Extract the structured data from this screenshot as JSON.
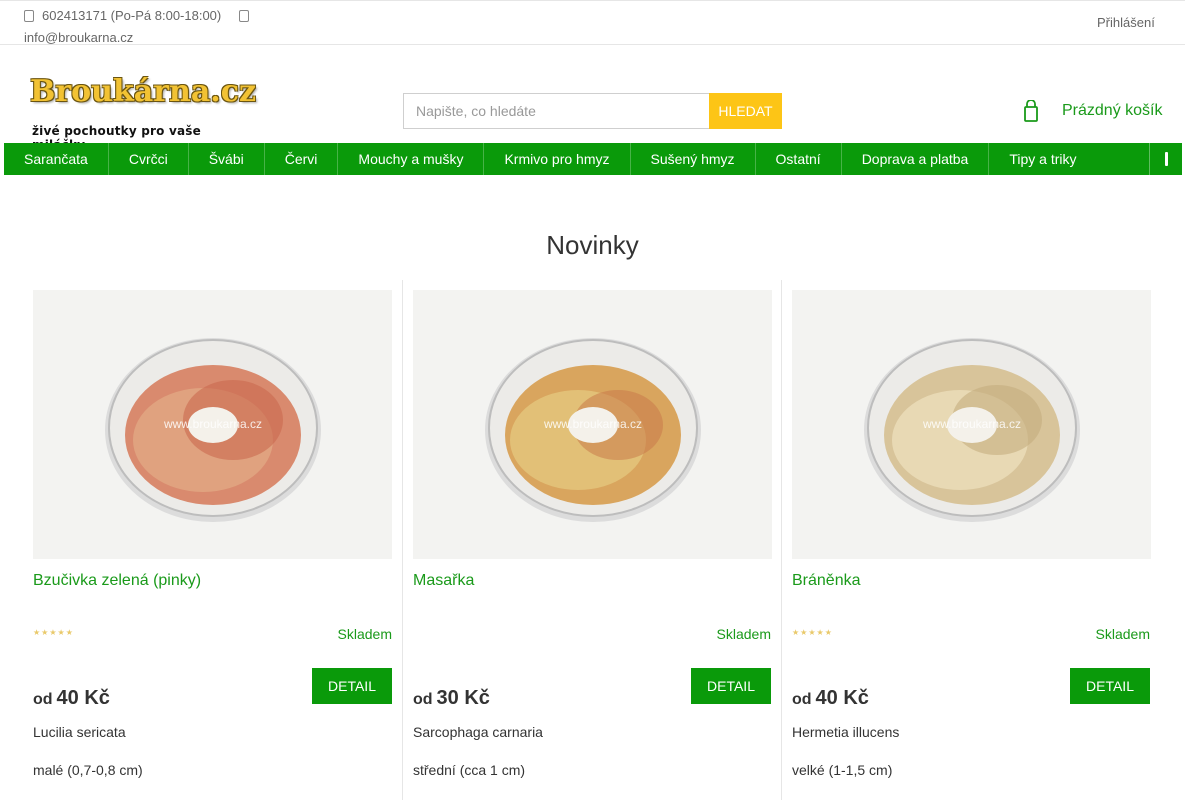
{
  "header": {
    "phone": "602413171 (Po-Pá 8:00-18:00)",
    "email": "info@broukarna.cz",
    "login_label": "Přihlášení",
    "phone_icon": "phone-icon",
    "email_icon": "envelope-icon"
  },
  "logo": {
    "title": "Broukárna.cz",
    "subtitle": "živé pochoutky pro vaše miláčky ..."
  },
  "search": {
    "placeholder": "Napište, co hledáte",
    "button_label": "HLEDAT"
  },
  "cart": {
    "label": "Prázdný košík",
    "icon": "cart-icon"
  },
  "nav": {
    "items": [
      "Sarančata",
      "Cvrčci",
      "Švábi",
      "Červi",
      "Mouchy a mušky",
      "Krmivo pro hmyz",
      "Sušený hmyz",
      "Ostatní",
      "Doprava a platba",
      "Tipy a triky"
    ],
    "menu_icon": "menu-toggle-icon"
  },
  "section": {
    "title": "Novinky"
  },
  "products": [
    {
      "name": "Bzučivka zelená (pinky)",
      "stock": "Skladem",
      "price_prefix": "od",
      "price": "40 Kč",
      "detail_label": "DETAIL",
      "latin": "Lucilia sericata",
      "size": "malé (0,7-0,8 cm)",
      "watermark": "www.broukarna.cz",
      "rating": 0,
      "show_stars": true
    },
    {
      "name": "Masařka",
      "stock": "Skladem",
      "price_prefix": "od",
      "price": "30 Kč",
      "detail_label": "DETAIL",
      "latin": "Sarcophaga carnaria",
      "size": "střední (cca 1 cm)",
      "watermark": "www.broukarna.cz",
      "rating": 0,
      "show_stars": false
    },
    {
      "name": "Bráněnka",
      "stock": "Skladem",
      "price_prefix": "od",
      "price": "40 Kč",
      "detail_label": "DETAIL",
      "latin": "Hermetia illucens",
      "size": "velké (1-1,5 cm)",
      "watermark": "www.broukarna.cz",
      "rating": 0,
      "show_stars": true
    }
  ],
  "colors": {
    "brand_green": "#0a9a0a",
    "link_green": "#1a9a1a",
    "search_yellow": "#fdc516"
  }
}
